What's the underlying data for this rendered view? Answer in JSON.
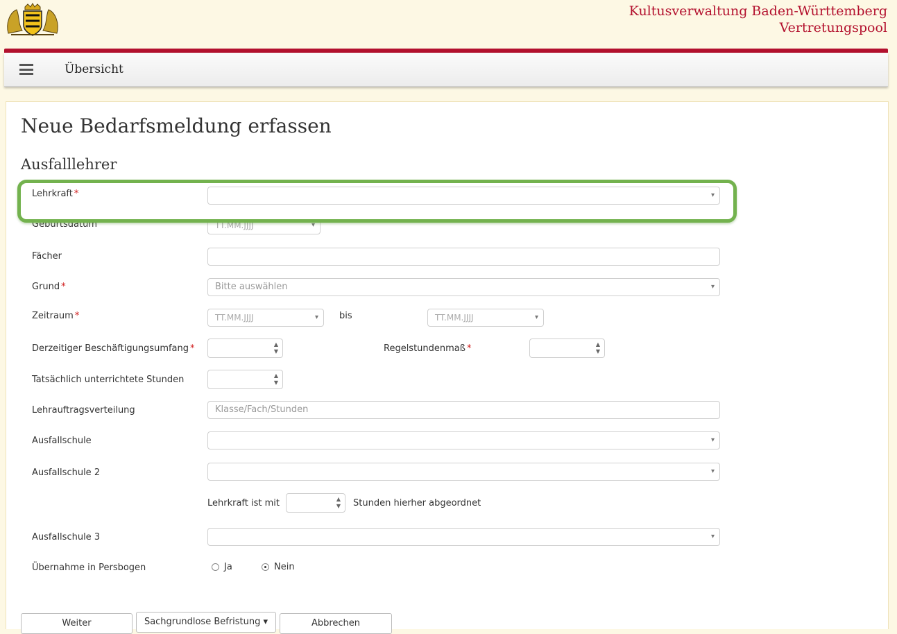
{
  "header": {
    "org_line1": "Kultusverwaltung Baden-Württemberg",
    "org_line2": "Vertretungspool",
    "logo_icon": "coat-of-arms-icon"
  },
  "nav": {
    "menu_icon": "hamburger-menu-icon",
    "title": "Übersicht"
  },
  "page": {
    "title": "Neue Bedarfsmeldung erfassen",
    "section": "Ausfalllehrer"
  },
  "colors": {
    "brand_red": "#b3112e",
    "required": "#d01c1c",
    "highlight_green": "#73b24e",
    "header_bg": "#fdf8e4"
  },
  "form": {
    "lehrkraft": {
      "label": "Lehrkraft",
      "required": "*",
      "value": ""
    },
    "geburtsdatum": {
      "label": "Geburtsdatum",
      "placeholder": "TT.MM.JJJJ"
    },
    "faecher": {
      "label": "Fächer",
      "value": ""
    },
    "grund": {
      "label": "Grund",
      "required": "*",
      "placeholder": "Bitte auswählen"
    },
    "zeitraum": {
      "label": "Zeitraum",
      "required": "*",
      "from_placeholder": "TT.MM.JJJJ",
      "bis": "bis",
      "to_placeholder": "TT.MM.JJJJ"
    },
    "beschaeftigungsumfang": {
      "label": "Derzeitiger Beschäftigungsumfang",
      "required": "*",
      "value": ""
    },
    "regelstundenmass": {
      "label": "Regelstundenmaß",
      "required": "*",
      "value": ""
    },
    "tatsaechlich": {
      "label": "Tatsächlich unterrichtete Stunden",
      "value": ""
    },
    "lehrauftrag": {
      "label": "Lehrauftragsverteilung",
      "placeholder": "Klasse/Fach/Stunden"
    },
    "ausfallschule": {
      "label": "Ausfallschule",
      "value": ""
    },
    "ausfallschule2": {
      "label": "Ausfallschule 2",
      "value": ""
    },
    "abgeordnet": {
      "prefix": "Lehrkraft ist mit",
      "suffix": "Stunden hierher abgeordnet",
      "value": ""
    },
    "ausfallschule3": {
      "label": "Ausfallschule 3",
      "value": ""
    },
    "persbogen": {
      "label": "Übernahme in Persbogen",
      "option_ja": "Ja",
      "option_nein": "Nein",
      "selected": "Nein"
    }
  },
  "buttons": {
    "weiter": "Weiter",
    "sachgrundlos": "Sachgrundlose Befristung",
    "sachgrundlos_caret": "▾",
    "abbrechen": "Abbrechen"
  }
}
